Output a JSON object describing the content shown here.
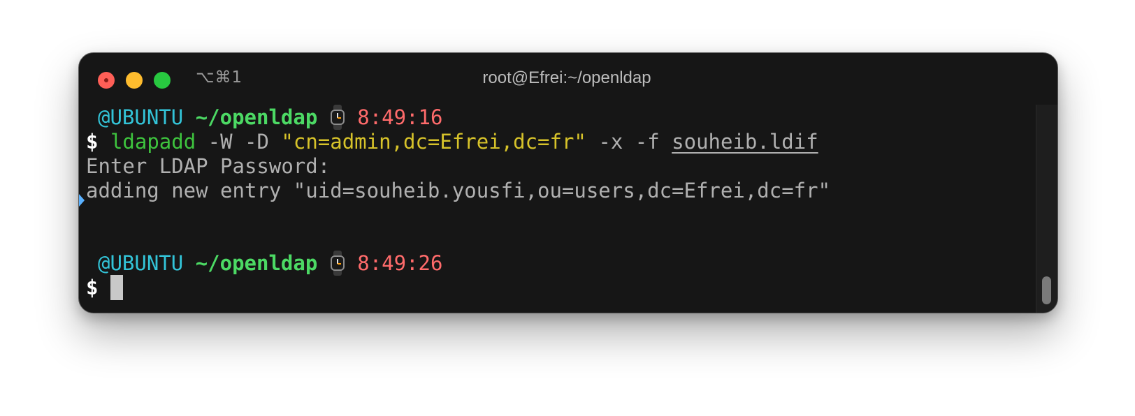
{
  "window": {
    "title": "root@Efrei:~/openldap",
    "shortcut": "⌥⌘1"
  },
  "colors": {
    "user": "#33c4d8",
    "path": "#4cd964",
    "time": "#ff6b6b",
    "command": "#3ec43e",
    "string": "#d7c32a",
    "output": "#b0b0b0",
    "background": "#161616"
  },
  "icons": {
    "prompt_clock": "watch-icon",
    "mark": "mark-arrow-icon"
  },
  "terminal": {
    "prompt1": {
      "user": "@UBUNTU",
      "path": "~/openldap",
      "time": "8:49:16"
    },
    "command": {
      "symbol": "$",
      "program": "ldapadd",
      "args1": "-W -D",
      "quoted": "\"cn=admin,dc=Efrei,dc=fr\"",
      "args2": "-x -f",
      "file": "souheib.ldif"
    },
    "output": [
      "Enter LDAP Password:",
      "adding new entry \"uid=souheib.yousfi,ou=users,dc=Efrei,dc=fr\""
    ],
    "prompt2": {
      "user": "@UBUNTU",
      "path": "~/openldap",
      "time": "8:49:26",
      "symbol": "$"
    }
  }
}
